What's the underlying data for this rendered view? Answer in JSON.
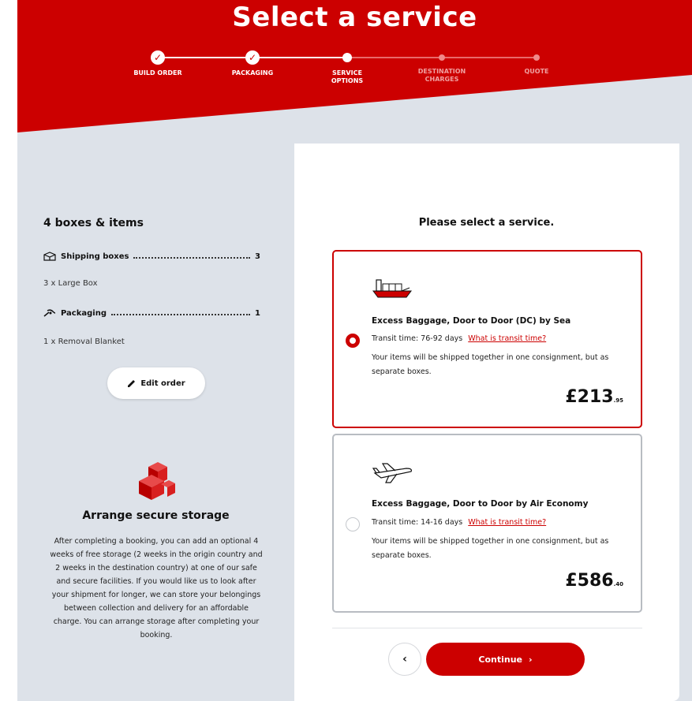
{
  "header": {
    "title": "Select a service"
  },
  "stepper": {
    "steps": [
      {
        "label": "BUILD ORDER",
        "state": "done"
      },
      {
        "label": "PACKAGING",
        "state": "done"
      },
      {
        "label": "SERVICE OPTIONS",
        "state": "current"
      },
      {
        "label": "DESTINATION CHARGES",
        "state": "todo"
      },
      {
        "label": "QUOTE",
        "state": "todo"
      }
    ]
  },
  "summary": {
    "title": "4 boxes & items",
    "shipping": {
      "label": "Shipping boxes",
      "count": "3",
      "detail": "3 x Large Box",
      "icon": "box-icon"
    },
    "packaging": {
      "label": "Packaging",
      "count": "1",
      "detail": "1 x Removal Blanket",
      "icon": "tape-icon"
    },
    "edit_label": "Edit order"
  },
  "storage": {
    "title": "Arrange secure storage",
    "text": "After completing a booking, you can add an optional 4 weeks of free storage (2 weeks in the origin country and 2 weeks in the destination country) at one of our safe and secure facilities. If you would like us to look after your shipment for longer, we can store your belongings between collection and delivery for an affordable charge. You can arrange storage after completing your booking."
  },
  "services": {
    "heading": "Please select a service.",
    "options": [
      {
        "title": "Excess Baggage, Door to Door (DC) by Sea",
        "transit": "Transit time: 76-92 days",
        "transit_link": "What is transit time?",
        "description": "Your items will be shipped together in one consignment, but as separate boxes.",
        "price_major": "£213",
        "price_minor": ".95",
        "selected": true,
        "icon": "ship-icon"
      },
      {
        "title": "Excess Baggage, Door to Door by Air Economy",
        "transit": "Transit time: 14-16 days",
        "transit_link": "What is transit time?",
        "description": "Your items will be shipped together in one consignment, but as separate boxes.",
        "price_major": "£586",
        "price_minor": ".40",
        "selected": false,
        "icon": "plane-icon"
      }
    ]
  },
  "nav": {
    "back_glyph": "‹",
    "continue_label": "Continue",
    "continue_glyph": "›"
  },
  "colors": {
    "brand": "#cc0000",
    "panel_bg": "#dde2e9"
  }
}
